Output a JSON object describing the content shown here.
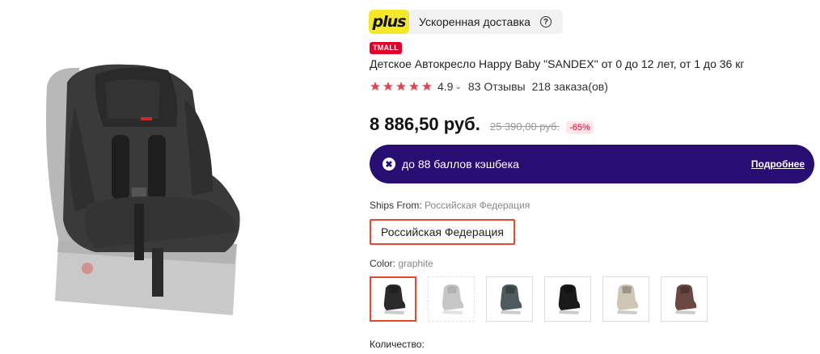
{
  "plus": {
    "logo": "plus",
    "text": "Ускоренная доставка",
    "help": "?"
  },
  "badge": "TMALL",
  "title": "Детское Автокресло Happy Baby \"SANDEX\" от 0 до 12 лет, от 1 до 36 кг",
  "rating": {
    "stars": 5,
    "value": "4.9",
    "reviews": "83 Отзывы",
    "orders": "218 заказа(ов)",
    "star_color": "#e8434b"
  },
  "price": {
    "current": "8 886,50 руб.",
    "old": "25 390,00 руб.",
    "discount": "-65%"
  },
  "cashback": {
    "text": "до 88 баллов кэшбека",
    "more": "Подробнее",
    "bg": "#280e73"
  },
  "ships": {
    "label": "Ships From:",
    "value": "Российская Федерация",
    "option": "Российская Федерация"
  },
  "color": {
    "label": "Color:",
    "value": "graphite",
    "swatches": [
      {
        "name": "graphite",
        "color": "#2b2b2b",
        "selected": true
      },
      {
        "name": "grey",
        "color": "#9a9a9a",
        "unavailable": true
      },
      {
        "name": "teal-grey",
        "color": "#4d5a5e"
      },
      {
        "name": "black",
        "color": "#1a1a1a"
      },
      {
        "name": "beige",
        "color": "#cfc6b4"
      },
      {
        "name": "brown",
        "color": "#6b4843"
      }
    ]
  },
  "quantity": {
    "label": "Количество:"
  },
  "accent": "#e4482f"
}
